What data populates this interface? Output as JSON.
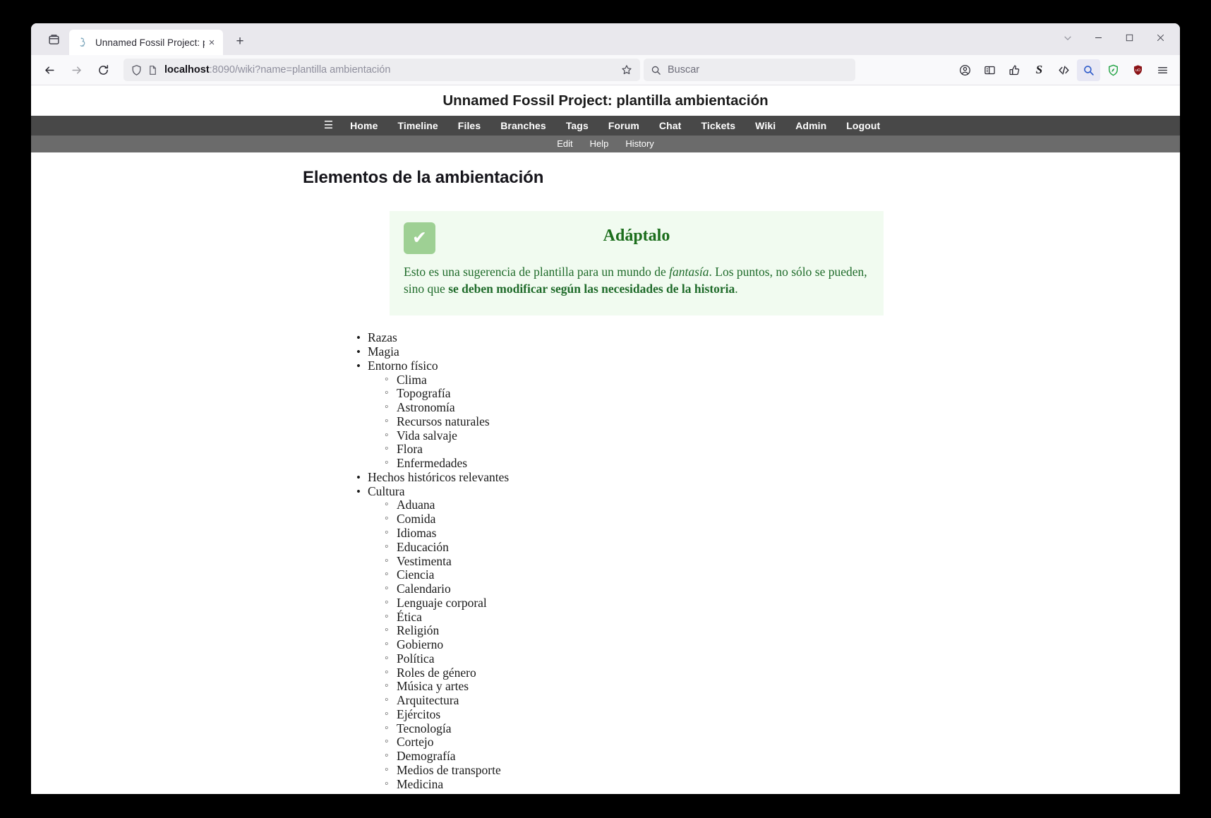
{
  "window": {
    "minimize_label": "Minimize",
    "maximize_label": "Maximize",
    "close_label": "Close"
  },
  "tabstrip": {
    "firefox_view_label": "Firefox View",
    "tab_title": "Unnamed Fossil Project: pl",
    "tab_close_label": "×",
    "new_tab_label": "+",
    "list_all_tabs_label": "List all tabs"
  },
  "navbar": {
    "back_label": "Back",
    "forward_label": "Forward",
    "reload_label": "Reload",
    "url_host": "localhost",
    "url_rest": ":8090/wiki?name=plantilla ambientación",
    "url_full": "localhost:8090/wiki?name=plantilla ambientación",
    "bookmark_label": "Bookmark this page",
    "search_placeholder": "Buscar",
    "extensions": [
      {
        "name": "account-icon",
        "label": "Account"
      },
      {
        "name": "sidebar-icon",
        "label": "Sidebar"
      },
      {
        "name": "thumbs-up-icon",
        "label": "Extension"
      },
      {
        "name": "stylus-s-icon",
        "label": "S"
      },
      {
        "name": "code-brackets-icon",
        "label": "</>"
      },
      {
        "name": "magnifier-extension-icon",
        "label": "Search"
      },
      {
        "name": "green-shield-icon",
        "label": "Privacy Badger"
      },
      {
        "name": "ublock-shield-icon",
        "label": "uBlock Origin"
      },
      {
        "name": "app-menu-icon",
        "label": "Open application menu"
      }
    ]
  },
  "fossil": {
    "project_title": "Unnamed Fossil Project: plantilla ambientación",
    "hamburger": "☰",
    "mainmenu": [
      "Home",
      "Timeline",
      "Files",
      "Branches",
      "Tags",
      "Forum",
      "Chat",
      "Tickets",
      "Wiki",
      "Admin",
      "Logout"
    ],
    "submenu": [
      "Edit",
      "Help",
      "History"
    ]
  },
  "wiki": {
    "heading": "Elementos de la ambientación",
    "callout": {
      "icon": "check-mark",
      "icon_glyph": "✔",
      "title": "Adáptalo",
      "text_part1": "Esto es una sugerencia de plantilla para un mundo de ",
      "text_italic": "fantasía",
      "text_part2": ". Los puntos, no sólo se pueden, sino que ",
      "text_bold": "se deben modificar según las necesidades de la historia",
      "text_part3": ".",
      "bg_color": "#f1fbf0",
      "text_color": "#1f6b2a",
      "title_color": "#1c6e1c",
      "icon_bg_color": "#9ed094"
    },
    "topics": [
      {
        "label": "Razas",
        "children": []
      },
      {
        "label": "Magia",
        "children": []
      },
      {
        "label": "Entorno físico",
        "children": [
          "Clima",
          "Topografía",
          "Astronomía",
          "Recursos naturales",
          "Vida salvaje",
          "Flora",
          "Enfermedades"
        ]
      },
      {
        "label": "Hechos históricos relevantes",
        "children": []
      },
      {
        "label": "Cultura",
        "children": [
          "Aduana",
          "Comida",
          "Idiomas",
          "Educación",
          "Vestimenta",
          "Ciencia",
          "Calendario",
          "Lenguaje corporal",
          "Ética",
          "Religión",
          "Gobierno",
          "Política",
          "Roles de género",
          "Música y artes",
          "Arquitectura",
          "Ejércitos",
          "Tecnología",
          "Cortejo",
          "Demografía",
          "Medios de transporte",
          "Medicina"
        ]
      }
    ]
  }
}
